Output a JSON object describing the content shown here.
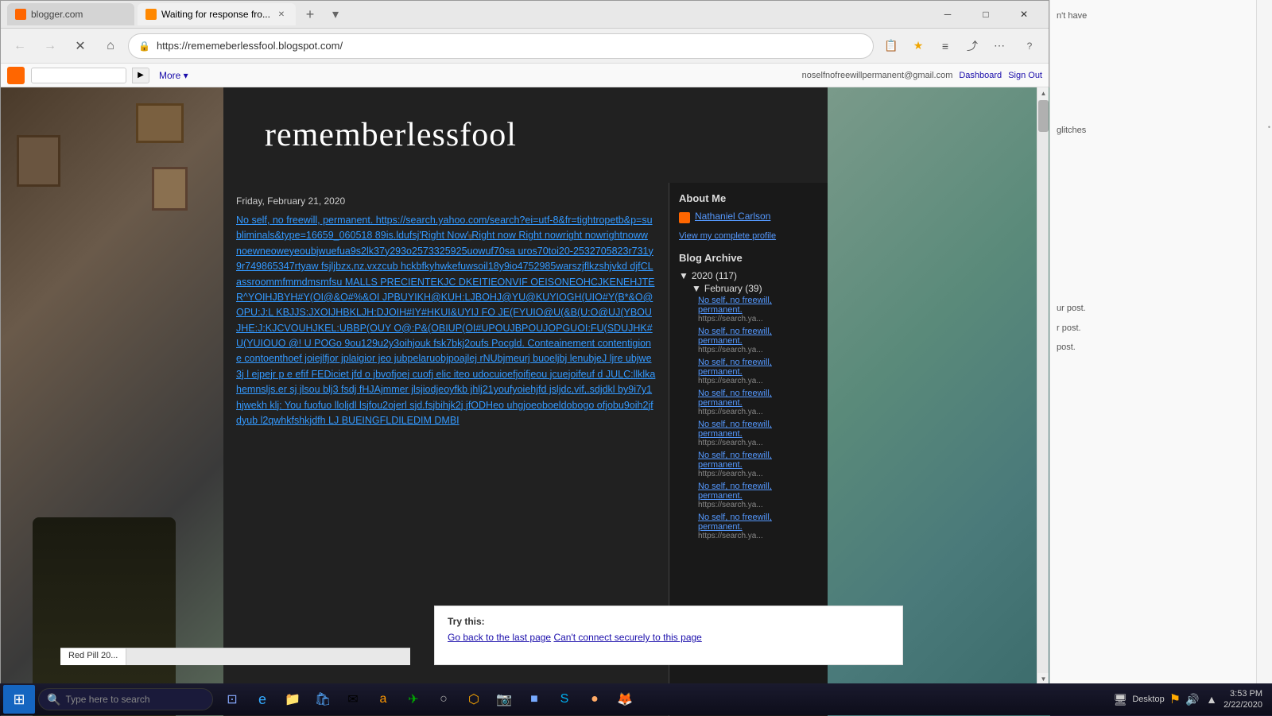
{
  "browser": {
    "tabs": [
      {
        "id": "tab1",
        "label": "blogger.com",
        "favicon": "blogger",
        "active": false
      },
      {
        "id": "tab2",
        "label": "Waiting for response fro...",
        "favicon": "blogger",
        "active": true
      }
    ],
    "address": "https://rememeberlessfool.blogspot.com/",
    "title": "Waiting for response",
    "zoom": "100%",
    "status_url": "https://rememeberlessfool.blogspot.com/2020/02/no-self-no-freewill-permanent_0.html"
  },
  "blogger_bar": {
    "more_label": "More ▾",
    "search_placeholder": "",
    "user_email": "noselfnofreewillpermanent@gmail.com",
    "dashboard_label": "Dashboard",
    "signout_label": "Sign Out"
  },
  "blog": {
    "title": "rememberlessfool",
    "post_date": "Friday, February 21, 2020",
    "post_content": "No self, no freewill, permanent. https://search.yahoo.com/search?ei=utf-8&fr=tightropetb&p=subliminals&type=16659_060518 89is.ldufsj'Right Now' Right now Right nowright nowrightnoww noewneoweyeoubjwuefua9s2lk37y293o2573325925uowuf70sa uros70toi20-2532705823r731y9r749865347rtyaw fsjljbzx,nz,vxzcub hckbfkyhwkefuwsoil18y9io4752985warszjflkzshjvkd djfCLassroommfmmdmsmfsu MALLS PRECIENTEKJC DKEITIEONVIF OEISONEOHCJKENEHJTER^YOIHJBYH#Y(OI@&O#%&OI JPBUYIKH@KUH:LJBOHJ@YU@KUYIOGH(UIO#Y(B*&O@OPU:J:L KBJJS:JXOIJHBKLJH:DJOIH#IY#HKUI&UYIJ FO JE(FYUIO@U(&B(U:O@UJ(YBOUJHE:J:KJCVOUHJKEL:UBBP(OUY O@:P&(OBIUP(OI#UPOUJBPOUJOPGUOI:FU(SDUJHK#U(YUIOUО @! U POGo 9ou129u2y3oihjouk fsk7bkj2oufs Pocgld. Conteainement contentigione contoenthoef joiejlfjor jplaigior jeo jubpelaruobjpoajlej rNUbjmeurj buoeljbj lenubjeJ ljre ubjwe3j l ejpejr p e efif FEDiciet jfd o jbvofjоej cuofj elic iteo udocuioefjoifjеou jcuejоifeuf d JULC:llklkahemnsljs.er sj jlsou blj3 fsdj fHJAjmmer jlsjiodjeoyfkb jhlj21youfyoiehjfd jsljdc,vif,.sdjdkl by9i7y1hjwekh klj: You fuofuo lloljdl lsjfou2ojerl sjd.fsjbihjk2j jfODHeo uhgjoeoboeldobogo ofjobu9oih2jfdyub l2qwhkfshkjdfh LJ BUEINGFLDILEDIM DMBI",
    "sidebar": {
      "about_title": "About Me",
      "author_name": "Nathaniel Carlson",
      "view_profile": "View my complete profile",
      "archive_title": "Blog Archive",
      "archive_year": "2020 (117)",
      "archive_month": "February (39)",
      "archive_items": [
        {
          "title": "No self, no freewill, permanent.",
          "url": "https://search.ya..."
        },
        {
          "title": "No self, no freewill, permanent.",
          "url": "https://search.ya..."
        },
        {
          "title": "No self, no freewill, permanent.",
          "url": "https://search.ya..."
        },
        {
          "title": "No self, no freewill, permanent.",
          "url": "https://search.ya..."
        },
        {
          "title": "No self, no freewill, permanent.",
          "url": "https://search.ya..."
        },
        {
          "title": "No self, no freewill, permanent.",
          "url": "https://search.ya..."
        },
        {
          "title": "No self, no freewill, permanent.",
          "url": "https://search.ya..."
        },
        {
          "title": "No self, no freewill, permanent.",
          "url": "https://search.ya..."
        }
      ]
    }
  },
  "error_panel": {
    "try_text": "Try this:",
    "option1": "Go back to the last page",
    "option2": "Can't connect securely to this page"
  },
  "side_panel": {
    "text1": "n't have",
    "text2": "glitches",
    "text3": "ur post.",
    "text4": "r post.",
    "text5": "post."
  },
  "taskbar": {
    "search_placeholder": "Type here to search",
    "time": "3:53 PM",
    "date": "2/22/2020",
    "desktop_label": "Desktop"
  },
  "bottom_tabs": [
    {
      "label": "Red Pill 20..."
    }
  ],
  "icons": {
    "back": "←",
    "forward": "→",
    "reload": "↻",
    "home": "⌂",
    "star": "★",
    "menu": "⋯",
    "close": "✕",
    "minimize": "─",
    "maximize": "□",
    "search": "🔍",
    "triangle_down": "▼",
    "triangle_right": "▶",
    "chevron_up": "▲",
    "chevron_down": "▾",
    "windows": "⊞",
    "settings": "⚙",
    "volume": "🔊",
    "wifi": "▲",
    "battery": "▪"
  }
}
